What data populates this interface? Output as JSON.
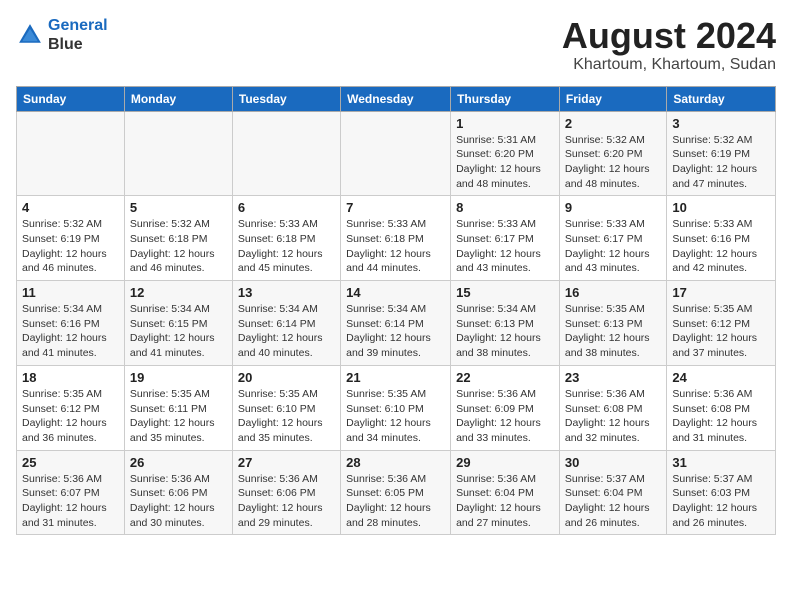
{
  "header": {
    "logo_line1": "General",
    "logo_line2": "Blue",
    "month_year": "August 2024",
    "location": "Khartoum, Khartoum, Sudan"
  },
  "weekdays": [
    "Sunday",
    "Monday",
    "Tuesday",
    "Wednesday",
    "Thursday",
    "Friday",
    "Saturday"
  ],
  "weeks": [
    [
      {
        "day": "",
        "detail": ""
      },
      {
        "day": "",
        "detail": ""
      },
      {
        "day": "",
        "detail": ""
      },
      {
        "day": "",
        "detail": ""
      },
      {
        "day": "1",
        "detail": "Sunrise: 5:31 AM\nSunset: 6:20 PM\nDaylight: 12 hours\nand 48 minutes."
      },
      {
        "day": "2",
        "detail": "Sunrise: 5:32 AM\nSunset: 6:20 PM\nDaylight: 12 hours\nand 48 minutes."
      },
      {
        "day": "3",
        "detail": "Sunrise: 5:32 AM\nSunset: 6:19 PM\nDaylight: 12 hours\nand 47 minutes."
      }
    ],
    [
      {
        "day": "4",
        "detail": "Sunrise: 5:32 AM\nSunset: 6:19 PM\nDaylight: 12 hours\nand 46 minutes."
      },
      {
        "day": "5",
        "detail": "Sunrise: 5:32 AM\nSunset: 6:18 PM\nDaylight: 12 hours\nand 46 minutes."
      },
      {
        "day": "6",
        "detail": "Sunrise: 5:33 AM\nSunset: 6:18 PM\nDaylight: 12 hours\nand 45 minutes."
      },
      {
        "day": "7",
        "detail": "Sunrise: 5:33 AM\nSunset: 6:18 PM\nDaylight: 12 hours\nand 44 minutes."
      },
      {
        "day": "8",
        "detail": "Sunrise: 5:33 AM\nSunset: 6:17 PM\nDaylight: 12 hours\nand 43 minutes."
      },
      {
        "day": "9",
        "detail": "Sunrise: 5:33 AM\nSunset: 6:17 PM\nDaylight: 12 hours\nand 43 minutes."
      },
      {
        "day": "10",
        "detail": "Sunrise: 5:33 AM\nSunset: 6:16 PM\nDaylight: 12 hours\nand 42 minutes."
      }
    ],
    [
      {
        "day": "11",
        "detail": "Sunrise: 5:34 AM\nSunset: 6:16 PM\nDaylight: 12 hours\nand 41 minutes."
      },
      {
        "day": "12",
        "detail": "Sunrise: 5:34 AM\nSunset: 6:15 PM\nDaylight: 12 hours\nand 41 minutes."
      },
      {
        "day": "13",
        "detail": "Sunrise: 5:34 AM\nSunset: 6:14 PM\nDaylight: 12 hours\nand 40 minutes."
      },
      {
        "day": "14",
        "detail": "Sunrise: 5:34 AM\nSunset: 6:14 PM\nDaylight: 12 hours\nand 39 minutes."
      },
      {
        "day": "15",
        "detail": "Sunrise: 5:34 AM\nSunset: 6:13 PM\nDaylight: 12 hours\nand 38 minutes."
      },
      {
        "day": "16",
        "detail": "Sunrise: 5:35 AM\nSunset: 6:13 PM\nDaylight: 12 hours\nand 38 minutes."
      },
      {
        "day": "17",
        "detail": "Sunrise: 5:35 AM\nSunset: 6:12 PM\nDaylight: 12 hours\nand 37 minutes."
      }
    ],
    [
      {
        "day": "18",
        "detail": "Sunrise: 5:35 AM\nSunset: 6:12 PM\nDaylight: 12 hours\nand 36 minutes."
      },
      {
        "day": "19",
        "detail": "Sunrise: 5:35 AM\nSunset: 6:11 PM\nDaylight: 12 hours\nand 35 minutes."
      },
      {
        "day": "20",
        "detail": "Sunrise: 5:35 AM\nSunset: 6:10 PM\nDaylight: 12 hours\nand 35 minutes."
      },
      {
        "day": "21",
        "detail": "Sunrise: 5:35 AM\nSunset: 6:10 PM\nDaylight: 12 hours\nand 34 minutes."
      },
      {
        "day": "22",
        "detail": "Sunrise: 5:36 AM\nSunset: 6:09 PM\nDaylight: 12 hours\nand 33 minutes."
      },
      {
        "day": "23",
        "detail": "Sunrise: 5:36 AM\nSunset: 6:08 PM\nDaylight: 12 hours\nand 32 minutes."
      },
      {
        "day": "24",
        "detail": "Sunrise: 5:36 AM\nSunset: 6:08 PM\nDaylight: 12 hours\nand 31 minutes."
      }
    ],
    [
      {
        "day": "25",
        "detail": "Sunrise: 5:36 AM\nSunset: 6:07 PM\nDaylight: 12 hours\nand 31 minutes."
      },
      {
        "day": "26",
        "detail": "Sunrise: 5:36 AM\nSunset: 6:06 PM\nDaylight: 12 hours\nand 30 minutes."
      },
      {
        "day": "27",
        "detail": "Sunrise: 5:36 AM\nSunset: 6:06 PM\nDaylight: 12 hours\nand 29 minutes."
      },
      {
        "day": "28",
        "detail": "Sunrise: 5:36 AM\nSunset: 6:05 PM\nDaylight: 12 hours\nand 28 minutes."
      },
      {
        "day": "29",
        "detail": "Sunrise: 5:36 AM\nSunset: 6:04 PM\nDaylight: 12 hours\nand 27 minutes."
      },
      {
        "day": "30",
        "detail": "Sunrise: 5:37 AM\nSunset: 6:04 PM\nDaylight: 12 hours\nand 26 minutes."
      },
      {
        "day": "31",
        "detail": "Sunrise: 5:37 AM\nSunset: 6:03 PM\nDaylight: 12 hours\nand 26 minutes."
      }
    ]
  ]
}
